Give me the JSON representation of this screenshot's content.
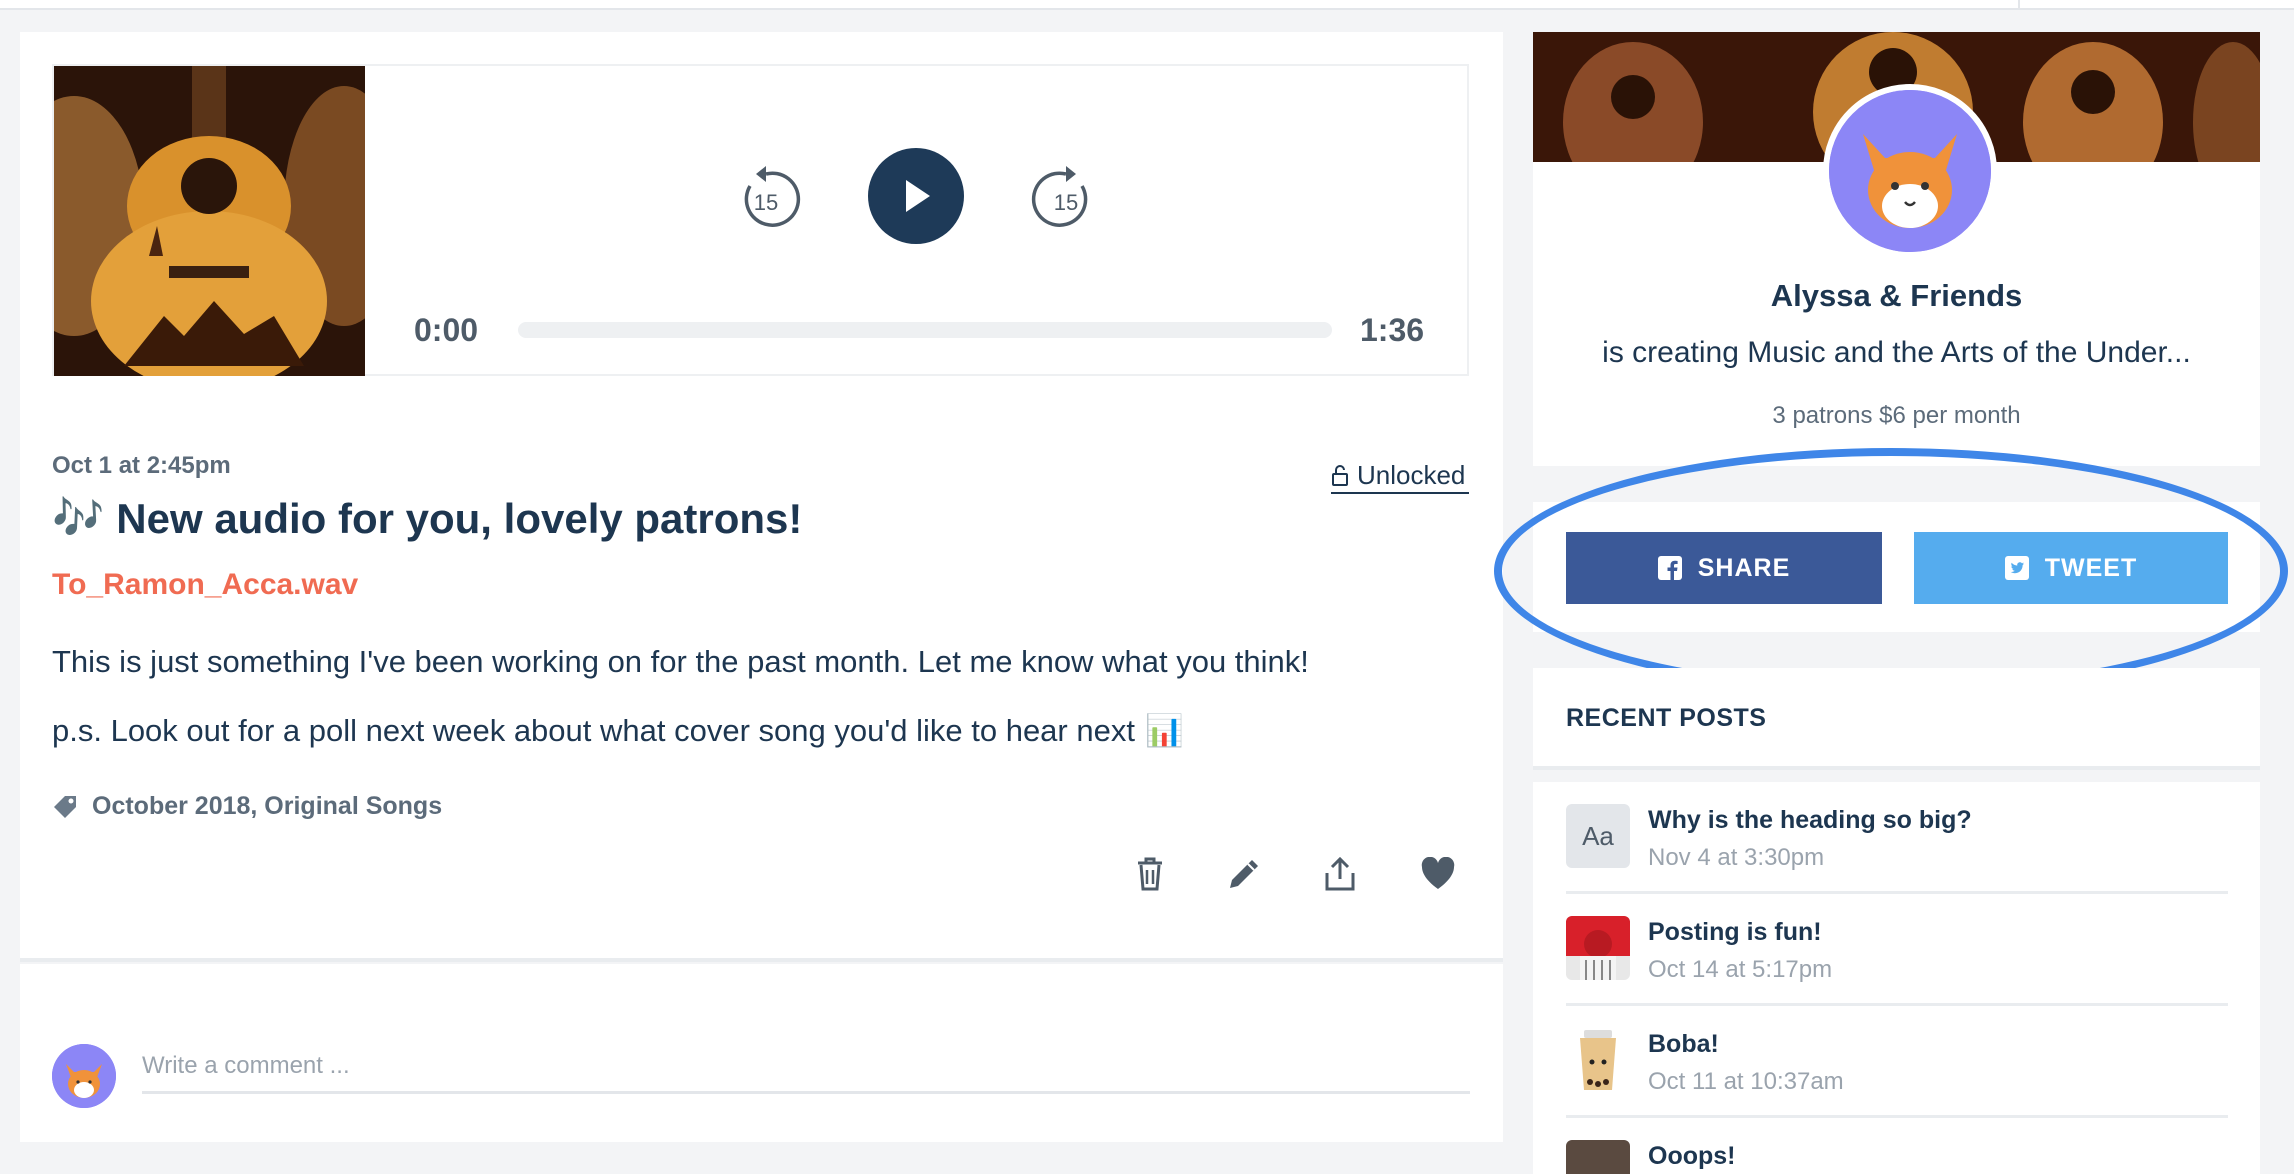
{
  "player": {
    "rewind_label": "15",
    "forward_label": "15",
    "current_time": "0:00",
    "total_time": "1:36",
    "progress": 0
  },
  "post": {
    "date": "Oct 1 at 2:45pm",
    "lock_status": "Unlocked",
    "title_emoji": "🎶",
    "title": "New audio for you, lovely patrons!",
    "file_name": "To_Ramon_Acca.wav",
    "body_line1": "This is just something I've been working on for the past month. Let me know what you think!",
    "body_line2": "p.s. Look out for a poll next week about what cover song you'd like to hear next",
    "body_emoji": "📊",
    "tags": "October 2018, Original Songs",
    "actions": [
      "trash-icon",
      "pencil-icon",
      "share-upload-icon",
      "heart-icon"
    ]
  },
  "comment": {
    "placeholder": "Write a comment ..."
  },
  "creator": {
    "name": "Alyssa & Friends",
    "creating": "is creating Music and the Arts of the Under...",
    "stats": "3 patrons  $6 per month"
  },
  "share": {
    "share_label": "SHARE",
    "tweet_label": "TWEET",
    "share_color": "#3b5998",
    "tweet_color": "#55acee",
    "highlight_color": "#3f86e8"
  },
  "recent": {
    "heading": "RECENT POSTS",
    "items": [
      {
        "thumb_text": "Aa",
        "title": "Why is the heading so big?",
        "date": "Nov 4 at 3:30pm"
      },
      {
        "thumb_text": "",
        "title": "Posting is fun!",
        "date": "Oct 14 at 5:17pm"
      },
      {
        "thumb_text": "",
        "title": "Boba!",
        "date": "Oct 11 at 10:37am"
      },
      {
        "thumb_text": "",
        "title": "Ooops!",
        "date": ""
      }
    ]
  },
  "colors": {
    "accent": "#f06b52",
    "navy": "#1d3650",
    "play_button": "#1e3a58"
  }
}
